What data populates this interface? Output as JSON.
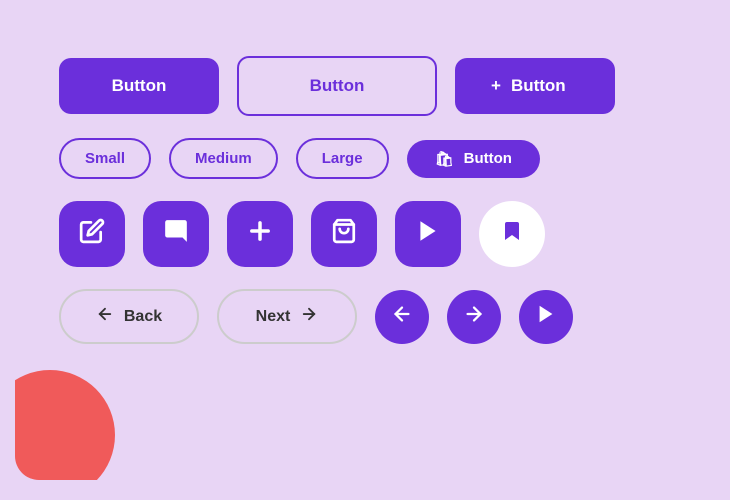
{
  "buttons": {
    "row1": {
      "btn1": "Button",
      "btn2": "Button",
      "btn3_icon": "+",
      "btn3_label": "Button"
    },
    "row2": {
      "small": "Small",
      "medium": "Medium",
      "large": "Large",
      "bag_label": "Button"
    },
    "row4": {
      "back": "Back",
      "next": "Next"
    }
  },
  "icons": {
    "pencil": "✏",
    "chat": "💬",
    "plus": "+",
    "bag": "🛍",
    "play": "▶",
    "bookmark": "🔖",
    "arrow_left": "←",
    "arrow_right": "→"
  },
  "colors": {
    "primary": "#6b2fdb",
    "outline_border": "#6b2fdb",
    "bg": "#e8d5f5",
    "blob": "#f05a5a",
    "white": "#ffffff"
  }
}
